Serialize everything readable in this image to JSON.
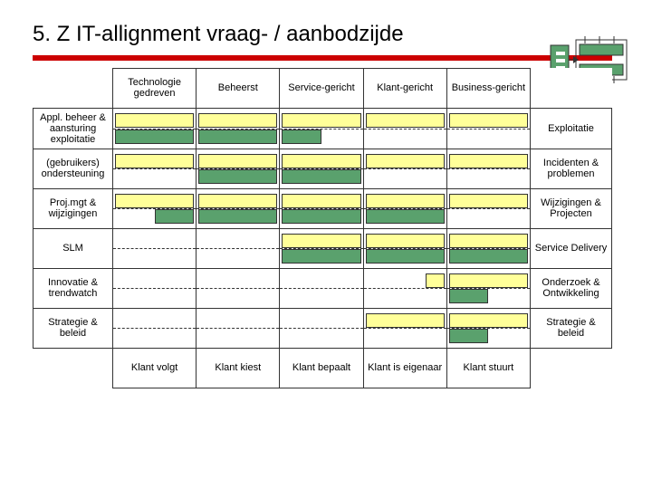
{
  "title": "5. Z IT-allignment vraag- / aanbodzijde",
  "headers": {
    "col1": "Technologie gedreven",
    "col2": "Beheerst",
    "col3": "Service-gericht",
    "col4": "Klant-gericht",
    "col5": "Business-gericht"
  },
  "rows": {
    "r1": {
      "label": "Appl. beheer & aansturing exploitatie",
      "right": "Exploitatie"
    },
    "r2": {
      "label": "(gebruikers) ondersteuning",
      "right": "Incidenten & problemen"
    },
    "r3": {
      "label": "Proj.mgt & wijzigingen",
      "right": "Wijzigingen & Projecten"
    },
    "r4": {
      "label": "SLM",
      "right": "Service Delivery"
    },
    "r5": {
      "label": "Innovatie & trendwatch",
      "right": "Onderzoek & Ontwikkeling"
    },
    "r6": {
      "label": "Strategie & beleid",
      "right": "Strategie & beleid"
    }
  },
  "footers": {
    "f1": "Klant volgt",
    "f2": "Klant kiest",
    "f3": "Klant bepaalt",
    "f4": "Klant is eigenaar",
    "f5": "Klant stuurt"
  },
  "chart_data": {
    "type": "table",
    "note": "Matrix showing coverage per maturity stage (columns) per process area (rows). Yellow = upper band, Green = lower band. full/half/none approximate bar extent within the cell.",
    "columns": [
      "Technologie gedreven",
      "Beheerst",
      "Service-gericht",
      "Klant-gericht",
      "Business-gericht"
    ],
    "rows": [
      "Appl. beheer & aansturing exploitatie",
      "(gebruikers) ondersteuning",
      "Proj.mgt & wijzigingen",
      "SLM",
      "Innovatie & trendwatch",
      "Strategie & beleid"
    ],
    "yellow": [
      [
        "full",
        "full",
        "full",
        "full",
        "full"
      ],
      [
        "full",
        "full",
        "full",
        "full",
        "full"
      ],
      [
        "full",
        "full",
        "full",
        "full",
        "full"
      ],
      [
        "none",
        "none",
        "full",
        "full",
        "full"
      ],
      [
        "none",
        "none",
        "none",
        "right-quarter",
        "full"
      ],
      [
        "none",
        "none",
        "none",
        "full",
        "full"
      ]
    ],
    "green": [
      [
        "full",
        "full",
        "half-left",
        "none",
        "none"
      ],
      [
        "none",
        "full",
        "full",
        "none",
        "none"
      ],
      [
        "half-right",
        "full",
        "full",
        "full",
        "none"
      ],
      [
        "none",
        "none",
        "full",
        "full",
        "full"
      ],
      [
        "none",
        "none",
        "none",
        "none",
        "half-left"
      ],
      [
        "none",
        "none",
        "none",
        "none",
        "half-left"
      ]
    ],
    "footer_labels": [
      "Klant volgt",
      "Klant kiest",
      "Klant bepaalt",
      "Klant is eigenaar",
      "Klant stuurt"
    ]
  }
}
